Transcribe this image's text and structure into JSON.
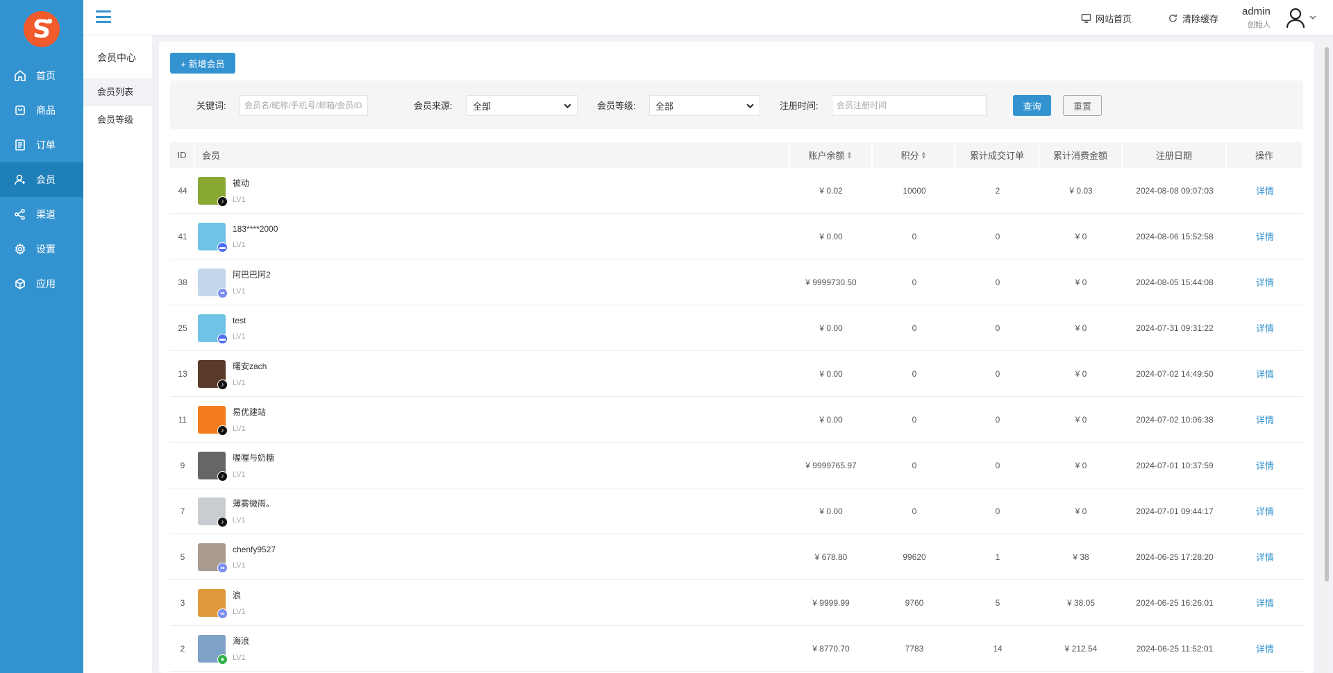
{
  "sidebar": {
    "logo_letter": "S",
    "items": [
      {
        "label": "首页",
        "icon": "home-icon",
        "active": false
      },
      {
        "label": "商品",
        "icon": "shopping-bag-icon",
        "active": false
      },
      {
        "label": "订单",
        "icon": "order-list-icon",
        "active": false
      },
      {
        "label": "会员",
        "icon": "user-icon",
        "active": true
      },
      {
        "label": "渠道",
        "icon": "share-nodes-icon",
        "active": false
      },
      {
        "label": "设置",
        "icon": "gear-icon",
        "active": false
      },
      {
        "label": "应用",
        "icon": "cube-icon",
        "active": false
      }
    ]
  },
  "topbar": {
    "site_home": "网站首页",
    "clear_cache": "清除缓存",
    "user_name": "admin",
    "user_role": "创始人"
  },
  "subnav": {
    "title": "会员中心",
    "items": [
      {
        "label": "会员列表",
        "active": true
      },
      {
        "label": "会员等级",
        "active": false
      }
    ]
  },
  "toolbar": {
    "add_member": "+ 新增会员"
  },
  "filter": {
    "keyword_label": "关键词:",
    "keyword_placeholder": "会员名/昵称/手机号/邮箱/会员ID",
    "source_label": "会员来源:",
    "source_value": "全部",
    "level_label": "会员等级:",
    "level_value": "全部",
    "regtime_label": "注册时间:",
    "regtime_placeholder": "会员注册时间",
    "query": "查询",
    "reset": "重置"
  },
  "table": {
    "columns": [
      "ID",
      "会员",
      "账户余额",
      "积分",
      "累计成交订单",
      "累计消费金额",
      "注册日期",
      "操作"
    ],
    "sortable": [
      false,
      false,
      true,
      true,
      false,
      false,
      false,
      false
    ],
    "rows": [
      {
        "id": "44",
        "name": "被动",
        "level": "LV1",
        "source": "douyin",
        "avatar_color": "#8aa834",
        "balance": "¥ 0.02",
        "points": "10000",
        "orders": "2",
        "spend": "¥ 0.03",
        "date": "2024-08-08 09:07:03",
        "op": "详情"
      },
      {
        "id": "41",
        "name": "183****2000",
        "level": "LV1",
        "source": "qq",
        "avatar_color": "#6ec3e6",
        "balance": "¥ 0.00",
        "points": "0",
        "orders": "0",
        "spend": "¥ 0",
        "date": "2024-08-06 15:52:58",
        "op": "详情"
      },
      {
        "id": "38",
        "name": "阿巴巴阿2",
        "level": "LV1",
        "source": "h5",
        "avatar_color": "#c2d7ea",
        "balance": "¥ 9999730.50",
        "points": "0",
        "orders": "0",
        "spend": "¥ 0",
        "date": "2024-08-05 15:44:08",
        "op": "详情"
      },
      {
        "id": "25",
        "name": "test",
        "level": "LV1",
        "source": "qq",
        "avatar_color": "#6ec3e6",
        "balance": "¥ 0.00",
        "points": "0",
        "orders": "0",
        "spend": "¥ 0",
        "date": "2024-07-31 09:31:22",
        "op": "详情"
      },
      {
        "id": "13",
        "name": "曙安zach",
        "level": "LV1",
        "source": "douyin",
        "avatar_color": "#5a3a2a",
        "balance": "¥ 0.00",
        "points": "0",
        "orders": "0",
        "spend": "¥ 0",
        "date": "2024-07-02 14:49:50",
        "op": "详情"
      },
      {
        "id": "11",
        "name": "易优建站",
        "level": "LV1",
        "source": "douyin",
        "avatar_color": "#f37c1c",
        "balance": "¥ 0.00",
        "points": "0",
        "orders": "0",
        "spend": "¥ 0",
        "date": "2024-07-02 10:06:38",
        "op": "详情"
      },
      {
        "id": "9",
        "name": "喔喔与奶糖",
        "level": "LV1",
        "source": "douyin",
        "avatar_color": "#666666",
        "balance": "¥ 9999765.97",
        "points": "0",
        "orders": "0",
        "spend": "¥ 0",
        "date": "2024-07-01 10:37:59",
        "op": "详情"
      },
      {
        "id": "7",
        "name": "薄雾微雨。",
        "level": "LV1",
        "source": "douyin",
        "avatar_color": "#c9cdd2",
        "balance": "¥ 0.00",
        "points": "0",
        "orders": "0",
        "spend": "¥ 0",
        "date": "2024-07-01 09:44:17",
        "op": "详情"
      },
      {
        "id": "5",
        "name": "chenfy9527",
        "level": "LV1",
        "source": "h5",
        "avatar_color": "#a99b90",
        "balance": "¥ 678.80",
        "points": "99620",
        "orders": "1",
        "spend": "¥ 38",
        "date": "2024-06-25 17:28:20",
        "op": "详情"
      },
      {
        "id": "3",
        "name": "浪",
        "level": "LV1",
        "source": "h5",
        "avatar_color": "#e09a3c",
        "balance": "¥ 9999.99",
        "points": "9760",
        "orders": "5",
        "spend": "¥ 38.05",
        "date": "2024-06-25 16:26:01",
        "op": "详情"
      },
      {
        "id": "2",
        "name": "海浪",
        "level": "LV1",
        "source": "wechat",
        "avatar_color": "#7fa2c8",
        "balance": "¥ 8770.70",
        "points": "7783",
        "orders": "14",
        "spend": "¥ 212.54",
        "date": "2024-06-25 11:52:01",
        "op": "详情"
      }
    ]
  },
  "colors": {
    "primary": "#3393d0",
    "sidebar_active": "#1f7fb9",
    "logo": "#f15a2b"
  }
}
